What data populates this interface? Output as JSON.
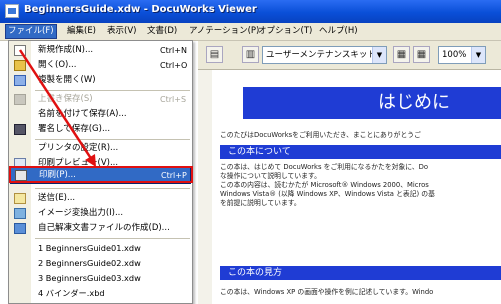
{
  "window": {
    "title": "BeginnersGuide.xdw - DocuWorks Viewer"
  },
  "menubar": [
    {
      "label": "ファイル(F)",
      "active": true
    },
    {
      "label": "編集(E)"
    },
    {
      "label": "表示(V)"
    },
    {
      "label": "文書(D)"
    },
    {
      "label": "アノテーション(P)"
    },
    {
      "label": "オプション(T)"
    },
    {
      "label": "ヘルプ(H)"
    }
  ],
  "toolbar": {
    "combo_text": "ユーザーメンテナンスキット品の文",
    "zoom": "100%"
  },
  "file_menu": {
    "items": [
      {
        "label": "新規作成(N)...",
        "shortcut": "Ctrl+N",
        "icon": "new-file-icon"
      },
      {
        "label": "開く(O)...",
        "shortcut": "Ctrl+O",
        "icon": "open-folder-icon"
      },
      {
        "label": "複製を開く(W)",
        "shortcut": "",
        "icon": "duplicate-icon"
      },
      {
        "label": "上書き保存(S)",
        "shortcut": "Ctrl+S",
        "icon": "save-icon",
        "disabled": true
      },
      {
        "label": "名前を付けて保存(A)...",
        "shortcut": ""
      },
      {
        "label": "署名して保存(G)...",
        "shortcut": "",
        "icon": "signature-icon"
      },
      {
        "label": "プリンタの設定(R)...",
        "shortcut": ""
      },
      {
        "label": "印刷プレビュー(V)...",
        "shortcut": "",
        "icon": "print-preview-icon"
      },
      {
        "label": "印刷(P)...",
        "shortcut": "Ctrl+P",
        "icon": "printer-icon",
        "selected": true
      },
      {
        "label": "送信(E)...",
        "shortcut": "",
        "icon": "mail-icon"
      },
      {
        "label": "イメージ変換出力(I)...",
        "shortcut": "",
        "icon": "image-export-icon"
      },
      {
        "label": "自己解凍文書ファイルの作成(D)...",
        "shortcut": "",
        "icon": "self-extract-icon"
      }
    ],
    "recent": [
      "1 BeginnersGuide01.xdw",
      "2 BeginnersGuide02.xdw",
      "3 BeginnersGuide03.xdw",
      "4 バインダー.xbd"
    ]
  },
  "document": {
    "heading": "はじめに",
    "intro": "このたびはDocuWorksをご利用いただき、まことにありがとうご",
    "section1": "この本について",
    "section1_lines": [
      "この本は、はじめて DocuWorks をご利用になるかたを対象に、Do",
      "な操作について説明しています。",
      "この本の内容は、読むかたが Microsoft® Windows 2000、Micros",
      "Windows Vista® (以降 Windows XP、Windows Vista と表記) の基",
      "を前提に説明しています。"
    ],
    "section2": "この本の見方",
    "section2_line": "この本は、Windows XP の画面や操作を例に記述しています。Windo"
  },
  "colors": {
    "accent": "#316ac5",
    "heading_bg": "#1f3cd4",
    "highlight": "#e01010"
  }
}
